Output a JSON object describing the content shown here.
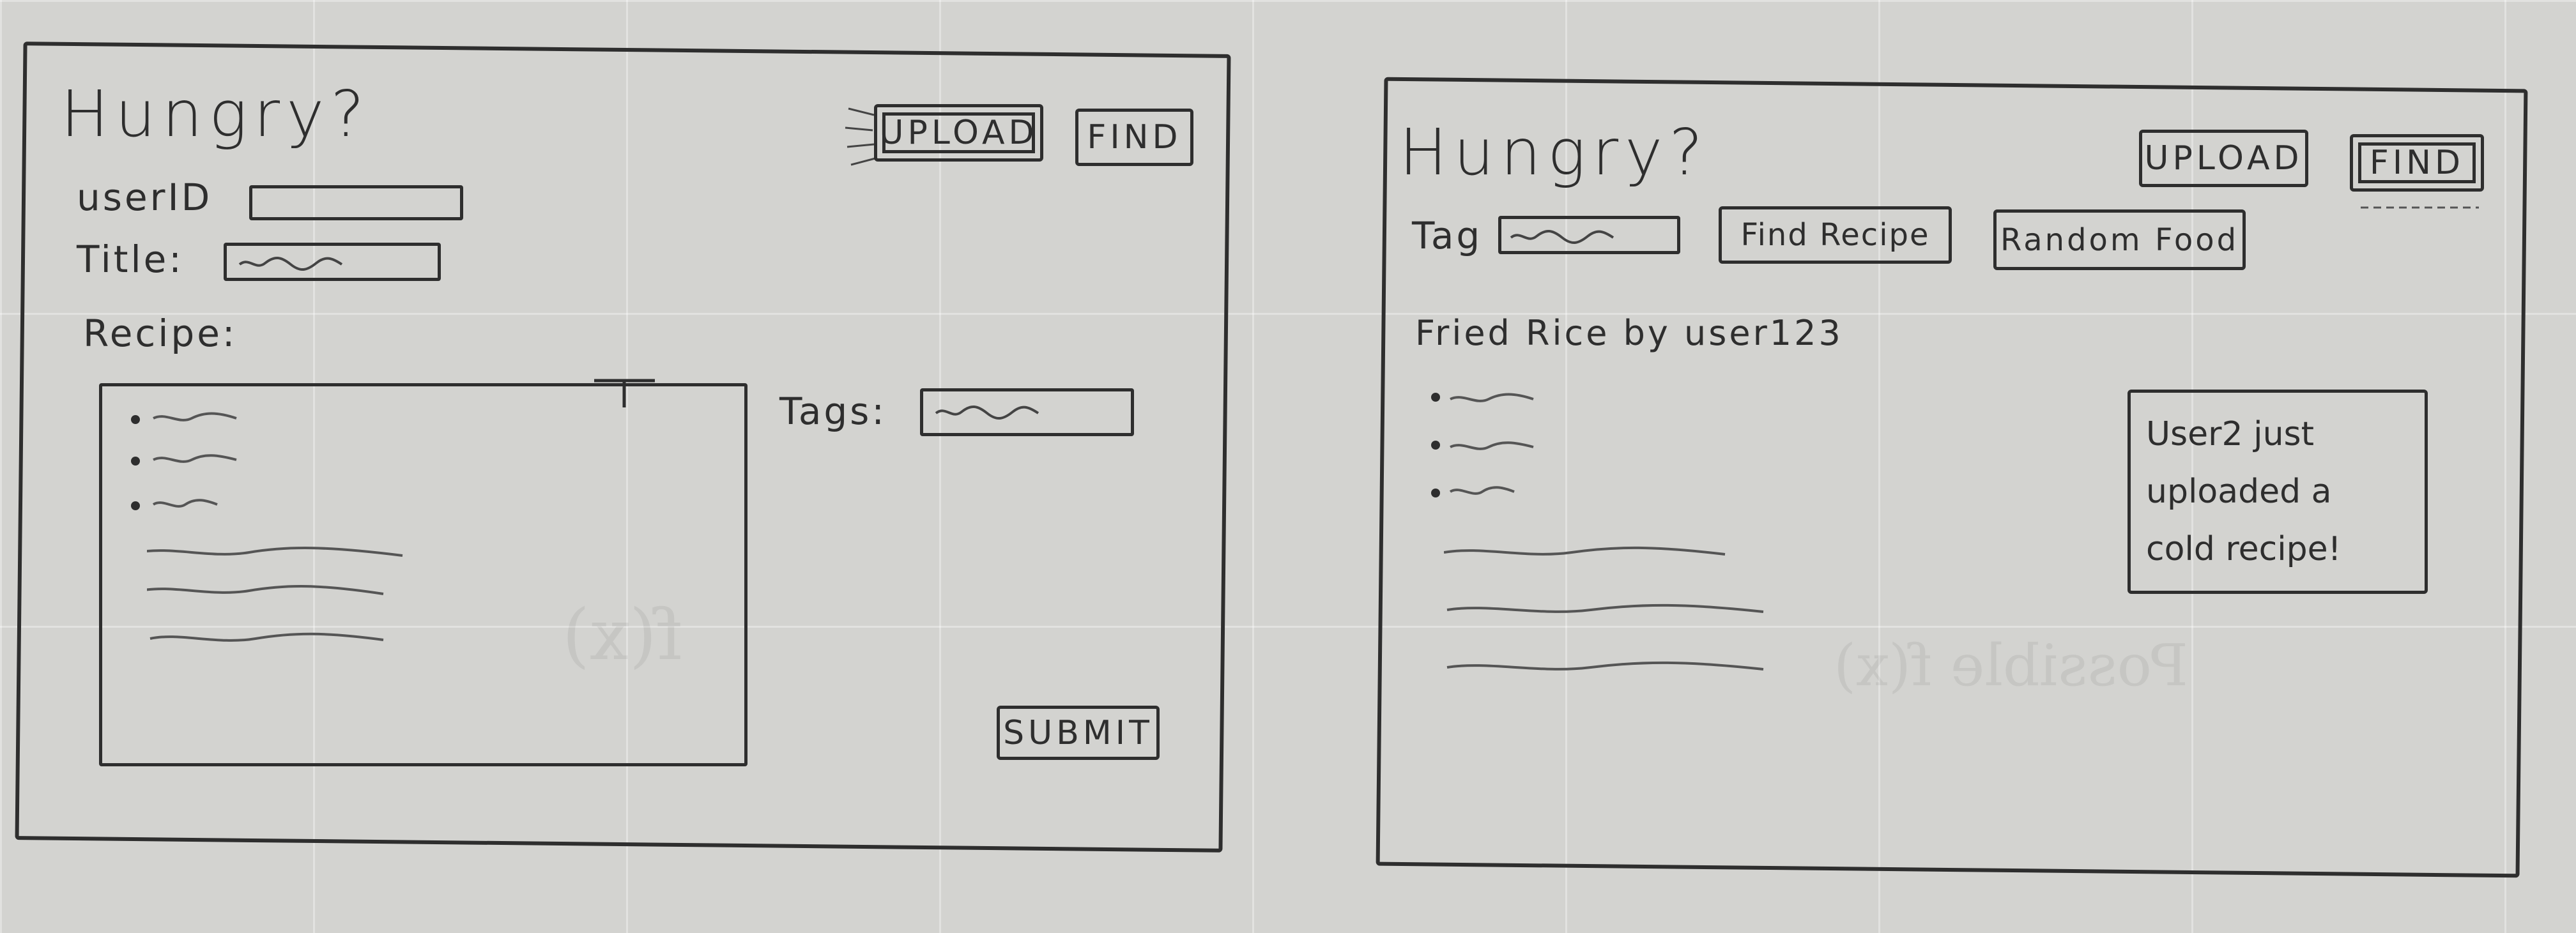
{
  "upload_screen": {
    "app_title": "Hungry?",
    "nav": {
      "upload": "UPLOAD",
      "find": "FIND"
    },
    "user_id_label": "userID",
    "title_label": "Title:",
    "recipe_label": "Recipe:",
    "tags_label": "Tags:",
    "submit": "SUBMIT"
  },
  "find_screen": {
    "app_title": "Hungry?",
    "nav": {
      "upload": "UPLOAD",
      "find": "FIND"
    },
    "tag_label": "Tag",
    "find_recipe": "Find Recipe",
    "random_food": "Random Food",
    "recipe_heading": "Fried Rice by user123",
    "notification": "User2 just uploaded a cold recipe!"
  },
  "background_text": {
    "ghost_1": "f(x)",
    "ghost_2": "Possible f(x)"
  }
}
